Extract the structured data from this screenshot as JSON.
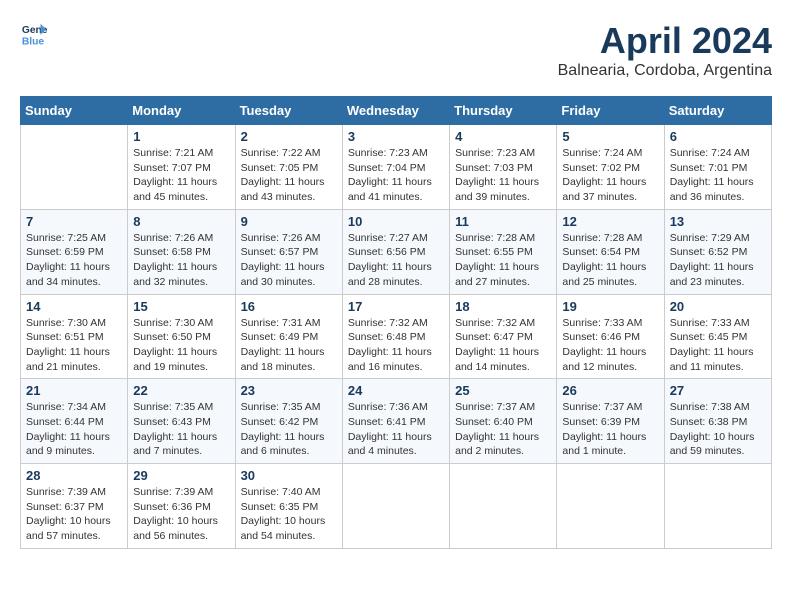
{
  "header": {
    "logo_line1": "General",
    "logo_line2": "Blue",
    "month_title": "April 2024",
    "subtitle": "Balnearia, Cordoba, Argentina"
  },
  "calendar": {
    "days_of_week": [
      "Sunday",
      "Monday",
      "Tuesday",
      "Wednesday",
      "Thursday",
      "Friday",
      "Saturday"
    ],
    "weeks": [
      [
        {
          "day": "",
          "info": ""
        },
        {
          "day": "1",
          "info": "Sunrise: 7:21 AM\nSunset: 7:07 PM\nDaylight: 11 hours\nand 45 minutes."
        },
        {
          "day": "2",
          "info": "Sunrise: 7:22 AM\nSunset: 7:05 PM\nDaylight: 11 hours\nand 43 minutes."
        },
        {
          "day": "3",
          "info": "Sunrise: 7:23 AM\nSunset: 7:04 PM\nDaylight: 11 hours\nand 41 minutes."
        },
        {
          "day": "4",
          "info": "Sunrise: 7:23 AM\nSunset: 7:03 PM\nDaylight: 11 hours\nand 39 minutes."
        },
        {
          "day": "5",
          "info": "Sunrise: 7:24 AM\nSunset: 7:02 PM\nDaylight: 11 hours\nand 37 minutes."
        },
        {
          "day": "6",
          "info": "Sunrise: 7:24 AM\nSunset: 7:01 PM\nDaylight: 11 hours\nand 36 minutes."
        }
      ],
      [
        {
          "day": "7",
          "info": "Sunrise: 7:25 AM\nSunset: 6:59 PM\nDaylight: 11 hours\nand 34 minutes."
        },
        {
          "day": "8",
          "info": "Sunrise: 7:26 AM\nSunset: 6:58 PM\nDaylight: 11 hours\nand 32 minutes."
        },
        {
          "day": "9",
          "info": "Sunrise: 7:26 AM\nSunset: 6:57 PM\nDaylight: 11 hours\nand 30 minutes."
        },
        {
          "day": "10",
          "info": "Sunrise: 7:27 AM\nSunset: 6:56 PM\nDaylight: 11 hours\nand 28 minutes."
        },
        {
          "day": "11",
          "info": "Sunrise: 7:28 AM\nSunset: 6:55 PM\nDaylight: 11 hours\nand 27 minutes."
        },
        {
          "day": "12",
          "info": "Sunrise: 7:28 AM\nSunset: 6:54 PM\nDaylight: 11 hours\nand 25 minutes."
        },
        {
          "day": "13",
          "info": "Sunrise: 7:29 AM\nSunset: 6:52 PM\nDaylight: 11 hours\nand 23 minutes."
        }
      ],
      [
        {
          "day": "14",
          "info": "Sunrise: 7:30 AM\nSunset: 6:51 PM\nDaylight: 11 hours\nand 21 minutes."
        },
        {
          "day": "15",
          "info": "Sunrise: 7:30 AM\nSunset: 6:50 PM\nDaylight: 11 hours\nand 19 minutes."
        },
        {
          "day": "16",
          "info": "Sunrise: 7:31 AM\nSunset: 6:49 PM\nDaylight: 11 hours\nand 18 minutes."
        },
        {
          "day": "17",
          "info": "Sunrise: 7:32 AM\nSunset: 6:48 PM\nDaylight: 11 hours\nand 16 minutes."
        },
        {
          "day": "18",
          "info": "Sunrise: 7:32 AM\nSunset: 6:47 PM\nDaylight: 11 hours\nand 14 minutes."
        },
        {
          "day": "19",
          "info": "Sunrise: 7:33 AM\nSunset: 6:46 PM\nDaylight: 11 hours\nand 12 minutes."
        },
        {
          "day": "20",
          "info": "Sunrise: 7:33 AM\nSunset: 6:45 PM\nDaylight: 11 hours\nand 11 minutes."
        }
      ],
      [
        {
          "day": "21",
          "info": "Sunrise: 7:34 AM\nSunset: 6:44 PM\nDaylight: 11 hours\nand 9 minutes."
        },
        {
          "day": "22",
          "info": "Sunrise: 7:35 AM\nSunset: 6:43 PM\nDaylight: 11 hours\nand 7 minutes."
        },
        {
          "day": "23",
          "info": "Sunrise: 7:35 AM\nSunset: 6:42 PM\nDaylight: 11 hours\nand 6 minutes."
        },
        {
          "day": "24",
          "info": "Sunrise: 7:36 AM\nSunset: 6:41 PM\nDaylight: 11 hours\nand 4 minutes."
        },
        {
          "day": "25",
          "info": "Sunrise: 7:37 AM\nSunset: 6:40 PM\nDaylight: 11 hours\nand 2 minutes."
        },
        {
          "day": "26",
          "info": "Sunrise: 7:37 AM\nSunset: 6:39 PM\nDaylight: 11 hours\nand 1 minute."
        },
        {
          "day": "27",
          "info": "Sunrise: 7:38 AM\nSunset: 6:38 PM\nDaylight: 10 hours\nand 59 minutes."
        }
      ],
      [
        {
          "day": "28",
          "info": "Sunrise: 7:39 AM\nSunset: 6:37 PM\nDaylight: 10 hours\nand 57 minutes."
        },
        {
          "day": "29",
          "info": "Sunrise: 7:39 AM\nSunset: 6:36 PM\nDaylight: 10 hours\nand 56 minutes."
        },
        {
          "day": "30",
          "info": "Sunrise: 7:40 AM\nSunset: 6:35 PM\nDaylight: 10 hours\nand 54 minutes."
        },
        {
          "day": "",
          "info": ""
        },
        {
          "day": "",
          "info": ""
        },
        {
          "day": "",
          "info": ""
        },
        {
          "day": "",
          "info": ""
        }
      ]
    ]
  }
}
